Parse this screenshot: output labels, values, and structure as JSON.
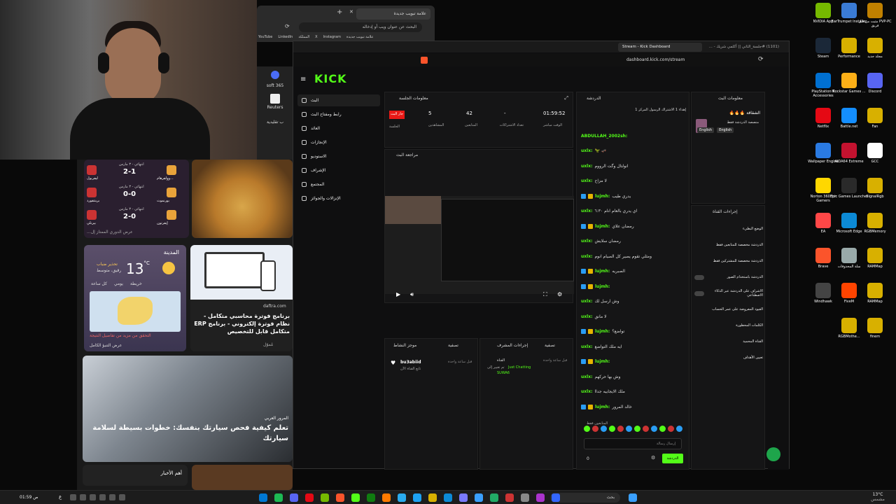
{
  "desktop_icons": [
    {
      "label": "NVIDIA App",
      "color": "#76b900",
      "col": 0,
      "row": 0
    },
    {
      "label": "EarTrumpet Installer",
      "color": "#3a7bd5",
      "col": 1,
      "row": 0
    },
    {
      "label": "مثبت من قبل PVP-PC فريق",
      "color": "#c08000",
      "col": 2,
      "row": 0
    },
    {
      "label": "Steam",
      "color": "#1b2838",
      "col": 0,
      "row": 1
    },
    {
      "label": "Performance",
      "color": "#d8b000",
      "col": 1,
      "row": 1
    },
    {
      "label": "مجلد جديد",
      "color": "#d8b000",
      "col": 2,
      "row": 1
    },
    {
      "label": "PlayStation® Accessories",
      "color": "#0070d1",
      "col": 0,
      "row": 2
    },
    {
      "label": "Rockstar Games ...",
      "color": "#fcaf17",
      "col": 1,
      "row": 2
    },
    {
      "label": "Discord",
      "color": "#5865f2",
      "col": 2,
      "row": 2
    },
    {
      "label": "Netflix",
      "color": "#e50914",
      "col": 0,
      "row": 3
    },
    {
      "label": "Battle.net",
      "color": "#148eff",
      "col": 1,
      "row": 3
    },
    {
      "label": "Fan",
      "color": "#d8b000",
      "col": 2,
      "row": 3
    },
    {
      "label": "Wallpaper Engine",
      "color": "#2a7ae2",
      "col": 0,
      "row": 4
    },
    {
      "label": "AIDA64 Extreme",
      "color": "#c3122f",
      "col": 1,
      "row": 4
    },
    {
      "label": "GCC",
      "color": "#ffffff",
      "col": 2,
      "row": 4
    },
    {
      "label": "Norton 360 for Gamers",
      "color": "#ffd700",
      "col": 0,
      "row": 5
    },
    {
      "label": "Epic Games Launcher",
      "color": "#2a2a2a",
      "col": 1,
      "row": 5
    },
    {
      "label": "SignalRgb",
      "color": "#d8b000",
      "col": 2,
      "row": 5
    },
    {
      "label": "EA",
      "color": "#ff4747",
      "col": 0,
      "row": 6
    },
    {
      "label": "Microsoft Edge",
      "color": "#0c8ad6",
      "col": 1,
      "row": 6
    },
    {
      "label": "RGBMemory",
      "color": "#d8b000",
      "col": 2,
      "row": 6
    },
    {
      "label": "Brave",
      "color": "#fb542b",
      "col": 0,
      "row": 7
    },
    {
      "label": "سلة المحذوفات",
      "color": "#9aa",
      "col": 1,
      "row": 7
    },
    {
      "label": "RAMMap",
      "color": "#d8b000",
      "col": 2,
      "row": 7
    },
    {
      "label": "Windhawk",
      "color": "#444",
      "col": 0,
      "row": 8
    },
    {
      "label": "FiveM",
      "color": "#f40",
      "col": 1,
      "row": 8
    },
    {
      "label": "RAMMap",
      "color": "#d8b000",
      "col": 2,
      "row": 8
    },
    {
      "label": "RGBMothe...",
      "color": "#d8b000",
      "col": 1,
      "row": 9
    },
    {
      "label": "finem",
      "color": "#d8b000",
      "col": 2,
      "row": 9
    }
  ],
  "back_browser": {
    "tab1": "علامة تبويب جديدة",
    "search_placeholder": "البحث عن عنوان ويب أو إدخاله",
    "bookmarks": [
      "YouTube",
      "LinkedIn",
      "المملكة",
      "X",
      "Instagram",
      "علامة تبويب جديدة"
    ]
  },
  "edge": {
    "news_tile": "soft 365",
    "reuters": "Reuters",
    "tag": "ب تقليدية",
    "matches": [
      {
        "home": "ليفربول",
        "away": "وولفرهام...",
        "score": "2-1",
        "date": "انتهائي - ٣ مارس"
      },
      {
        "home": "برينتفورد",
        "away": "بورنموث",
        "score": "0-0",
        "date": "انتهائي - ٣ مارس"
      },
      {
        "home": "بيرنلي",
        "away": "إيفرتون",
        "score": "2-0",
        "date": "انتهائي - ٣ مارس"
      }
    ],
    "league_link": "عرض الدوري الممتاز إل...",
    "weather": {
      "city": "المدينة",
      "temp": "13",
      "unit": "°C",
      "alert": "تحذير ضباب",
      "desc": "رقيق، متوسط",
      "tabs": [
        "كل ساعة",
        "يومي",
        "خريطة"
      ],
      "map_link": "التحقق من مزيد من تفاصيل النتيجة",
      "full": "عرض التنبؤ الكامل"
    },
    "ad": {
      "source": "daftra.com",
      "title": "برنامج فوترة محاسبي متكامل - نظام فوترة إلكتروني - برنامج ERP متكامل قابل للتخصيص",
      "sponsored": "مُموّل"
    },
    "article": {
      "source": "المرور العربي",
      "title": "تعلم كيفية فحص سيارتك بنفسك: خطوات بسيطة لسلامة سيارتك"
    },
    "footer": "أهم الأخبار"
  },
  "dashboard": {
    "tab1": "Stream - Kick Dashboard",
    "tab2": "(1101) #جلسة_الثاني || أكلمي شريك - ...",
    "url": "dashboard.kick.com/stream",
    "logo": "KICK",
    "nav": [
      "البث",
      "رابط ومفتاح البث",
      "العائد",
      "الإنجازات",
      "الاستوديو",
      "الإشراف",
      "المجتمع",
      "الإنزالات والجوائز"
    ],
    "session": {
      "title": "معلومات الجلسة",
      "live_badge": "جار البث",
      "live_label": "الجلسة",
      "viewers": "5",
      "viewers_label": "المشاهدين",
      "followers": "42",
      "followers_label": "المتابعين",
      "subs": "-",
      "subs_label": "تعداد الاشتراكات",
      "time": "01:59:52",
      "time_label": "الوقت مباشر"
    },
    "preview_title": "مراجعة البث",
    "feed_title": "موجز النشاط",
    "feed_filter": "تصفية",
    "feed_user": "bu3abiid",
    "feed_action": "تابع القناة الآن",
    "feed_time": "قبل ساعة واحدة",
    "mod_title": "إجراءات المشرف",
    "mod_filter": "تصفية",
    "mod_text": "القناة",
    "mod_category": "Just Chatting",
    "mod_to": "تم تغيير إلى",
    "mod_by": "SUWA6",
    "mod_time": "قبل ساعة واحدة",
    "chat_title": "الدردشة",
    "pinned": "إهداء 1 الاشتراك الرسول المركز 1",
    "chat": [
      {
        "user": "ABDULLAH_2002sh:",
        "msg": ""
      },
      {
        "user": "uxlx:",
        "msg": "🛹 🦖"
      },
      {
        "user": "uxlx:",
        "msg": "انولتال وگت الرووم"
      },
      {
        "user": "uxlx:",
        "msg": "لا مزاح"
      },
      {
        "user": "lujmh:",
        "msg": "يدري طيب"
      },
      {
        "user": "uxlx:",
        "msg": "اي يدري بالعام انام ٦:٣٠"
      },
      {
        "user": "lujmh:",
        "msg": "رمضان علاي"
      },
      {
        "user": "uxlx:",
        "msg": "رمضان سلايش"
      },
      {
        "user": "uxlx:",
        "msg": "ومثلي تقوم يصير كل الصيام انوم"
      },
      {
        "user": "lujmh:",
        "msg": "الصبريه"
      },
      {
        "user": "lujmh:",
        "msg": ""
      },
      {
        "user": "uxlx:",
        "msg": "وش ارسل لك"
      },
      {
        "user": "uxlx:",
        "msg": "لا مانق"
      },
      {
        "user": "lujmh:",
        "msg": "تواضع؟"
      },
      {
        "user": "uxlx:",
        "msg": "ايه ملك التواضع"
      },
      {
        "user": "lujmh:",
        "msg": ""
      },
      {
        "user": "uxlx:",
        "msg": "وش بها حركهم"
      },
      {
        "user": "uxlx:",
        "msg": "ملك الايجابيه جداا"
      },
      {
        "user": "lujmh:",
        "msg": "خالد المرور"
      }
    ],
    "followers_only": "المتابعون فقط",
    "chat_placeholder": "إرسال رسالة",
    "chat_btn": "الدردشة",
    "chat_count": "0",
    "stream_info": {
      "title": "معلومات البث",
      "stream_title": "الشقاقة 🔥🔥🔥",
      "category": "منصصة الدردشة فقط",
      "langs": [
        "English",
        "English"
      ]
    },
    "channel_actions": {
      "title": "إجراءات القناة",
      "items": [
        "الوضع البطيء",
        "الدردشة مخصصة للمتابعين فقط",
        "الدردشة مخصصة للمشتركين فقط",
        "الدردشة باستخدام الصور",
        "الاشراف على الدردشة عبر الذكاء الاصطناعي",
        "القيود المفروضة على عمر الحساب",
        "الكلمات المحظورة",
        "القناة المحمية",
        "تعيين الأهداف"
      ],
      "sub": "ث"
    }
  },
  "taskbar": {
    "search": "بحث",
    "weather": "13°C",
    "weather_desc": "مشمس",
    "lang": "ع",
    "time": "01:59 ص"
  }
}
